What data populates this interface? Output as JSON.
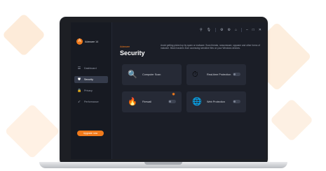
{
  "colors": {
    "accent": "#f07a1b",
    "screen_bg": "#1b1e27",
    "sidebar_bg": "#171a22",
    "card_bg": "#262a36"
  },
  "app": {
    "logo_letter": "A",
    "name": "Adaware 14"
  },
  "sidebar": {
    "items": [
      {
        "label": "Dashboard",
        "icon": "dashboard-icon",
        "glyph": "☰"
      },
      {
        "label": "Security",
        "icon": "shield-icon",
        "glyph": "⛊"
      },
      {
        "label": "Privacy",
        "icon": "lock-icon",
        "glyph": "🔒"
      },
      {
        "label": "Performance",
        "icon": "rocket-icon",
        "glyph": "➶"
      }
    ],
    "upgrade_label": "Upgrade now"
  },
  "titlebar": {
    "icons": [
      "search-icon",
      "microphone-icon",
      "gear-icon",
      "settings-icon",
      "home-icon",
      "minimize-icon",
      "maximize-icon",
      "close-icon"
    ],
    "glyphs": [
      "⚲",
      "🎙",
      "⚙",
      "⚙",
      "⌂",
      "–",
      "□",
      "✕"
    ]
  },
  "header": {
    "brand": "Adaware",
    "title": "Security",
    "description": "Avoid getting picked up by spam or malware. Scan threats, ransomware, spyware and other forms of malware. Block trackers from accessing sensitive files on your Windows devices."
  },
  "cards": {
    "scan": {
      "label": "Computer Scan",
      "icon": "scan-icon",
      "glyph": "🔍"
    },
    "realtime": {
      "label": "Real-time Protection",
      "icon": "clock-icon",
      "glyph": "⏱",
      "toggle": "off"
    },
    "firewall": {
      "label": "Firewall",
      "icon": "firewall-icon",
      "glyph": "🔥",
      "toggle": "off",
      "badge": "✹"
    },
    "web": {
      "label": "Web Protection",
      "icon": "globe-icon",
      "glyph": "🌐",
      "toggle": "off"
    }
  }
}
